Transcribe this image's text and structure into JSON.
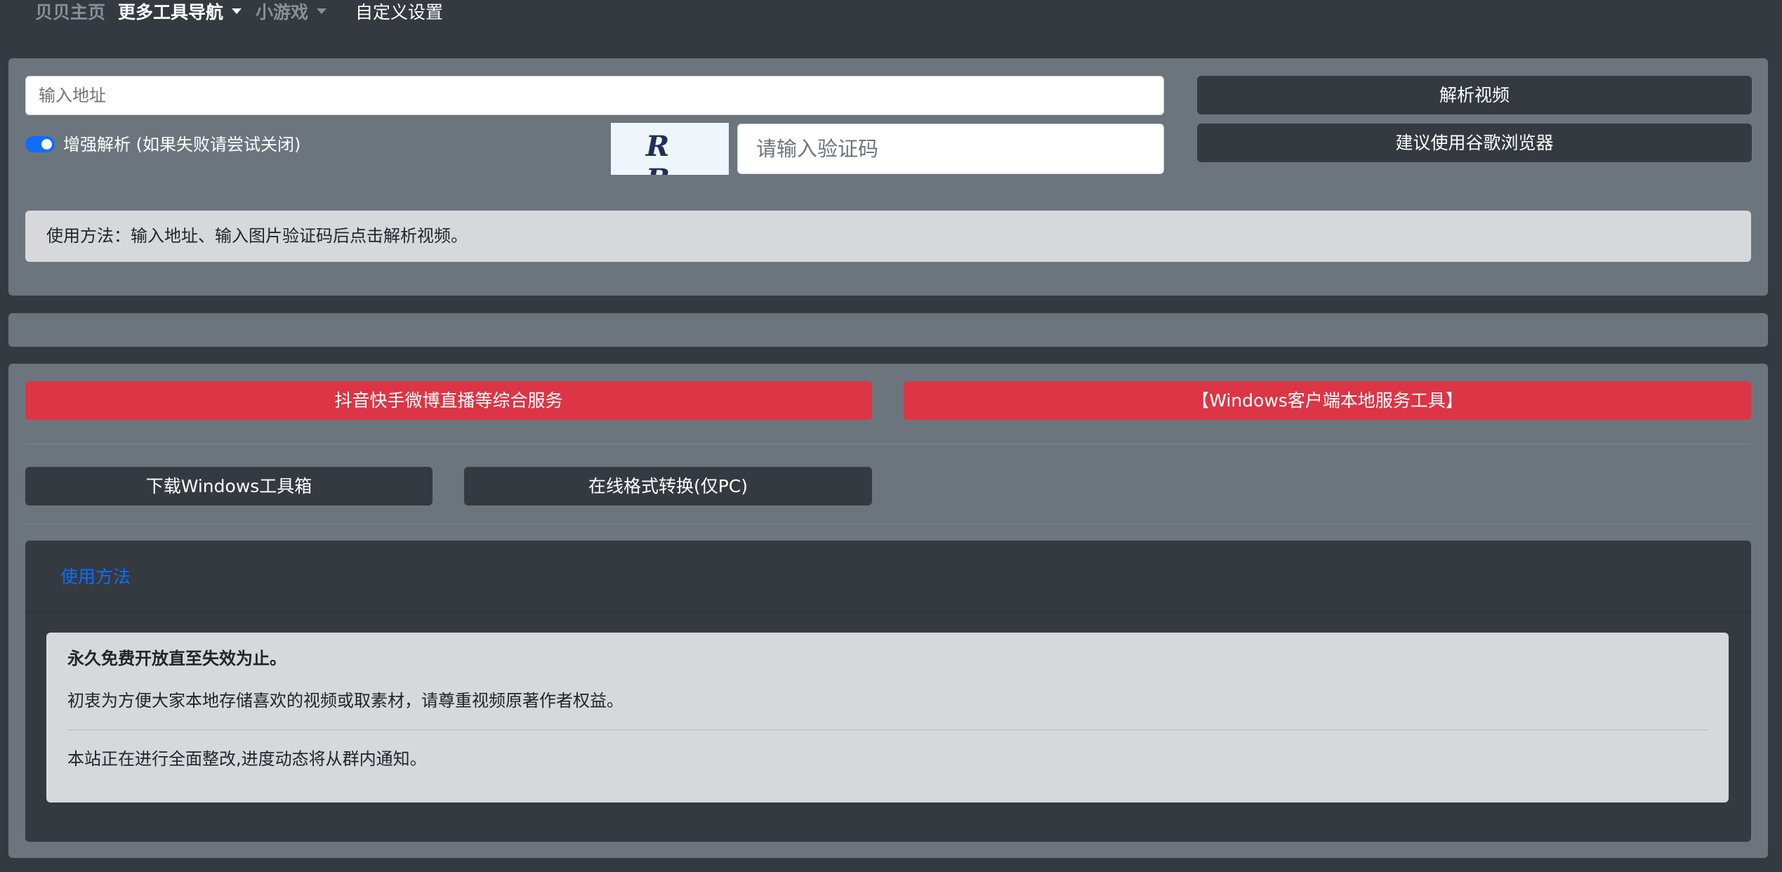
{
  "nav": {
    "home": "贝贝主页",
    "tools": "更多工具导航",
    "games": "小游戏",
    "settings": "自定义设置"
  },
  "parse_form": {
    "url_placeholder": "输入地址",
    "parse_button": "解析视频",
    "browser_button": "建议使用谷歌浏览器",
    "enhance_label": "增强解析 (如果失败请尝试关闭)",
    "enhance_on": true,
    "captcha_text": "R B",
    "captcha_placeholder": "请输入验证码",
    "usage_hint": "使用方法：输入地址、输入图片验证码后点击解析视频。"
  },
  "services": {
    "douyin_button": "抖音快手微博直播等综合服务",
    "windows_button": "【Windows客户端本地服务工具】",
    "download_button": "下载Windows工具箱",
    "convert_button": "在线格式转换(仅PC)"
  },
  "usage_card": {
    "title": "使用方法",
    "line1": "永久免费开放直至失效为止。",
    "line2": "初衷为方便大家本地存储喜欢的视频或取素材，请尊重视频原著作者权益。",
    "line3": "本站正在进行全面整改,进度动态将从群内通知。"
  },
  "colors": {
    "background": "#343a40",
    "panel": "#6c757d",
    "primary": "#0d6efd",
    "danger": "#dc3545",
    "light": "#d6d8db"
  }
}
